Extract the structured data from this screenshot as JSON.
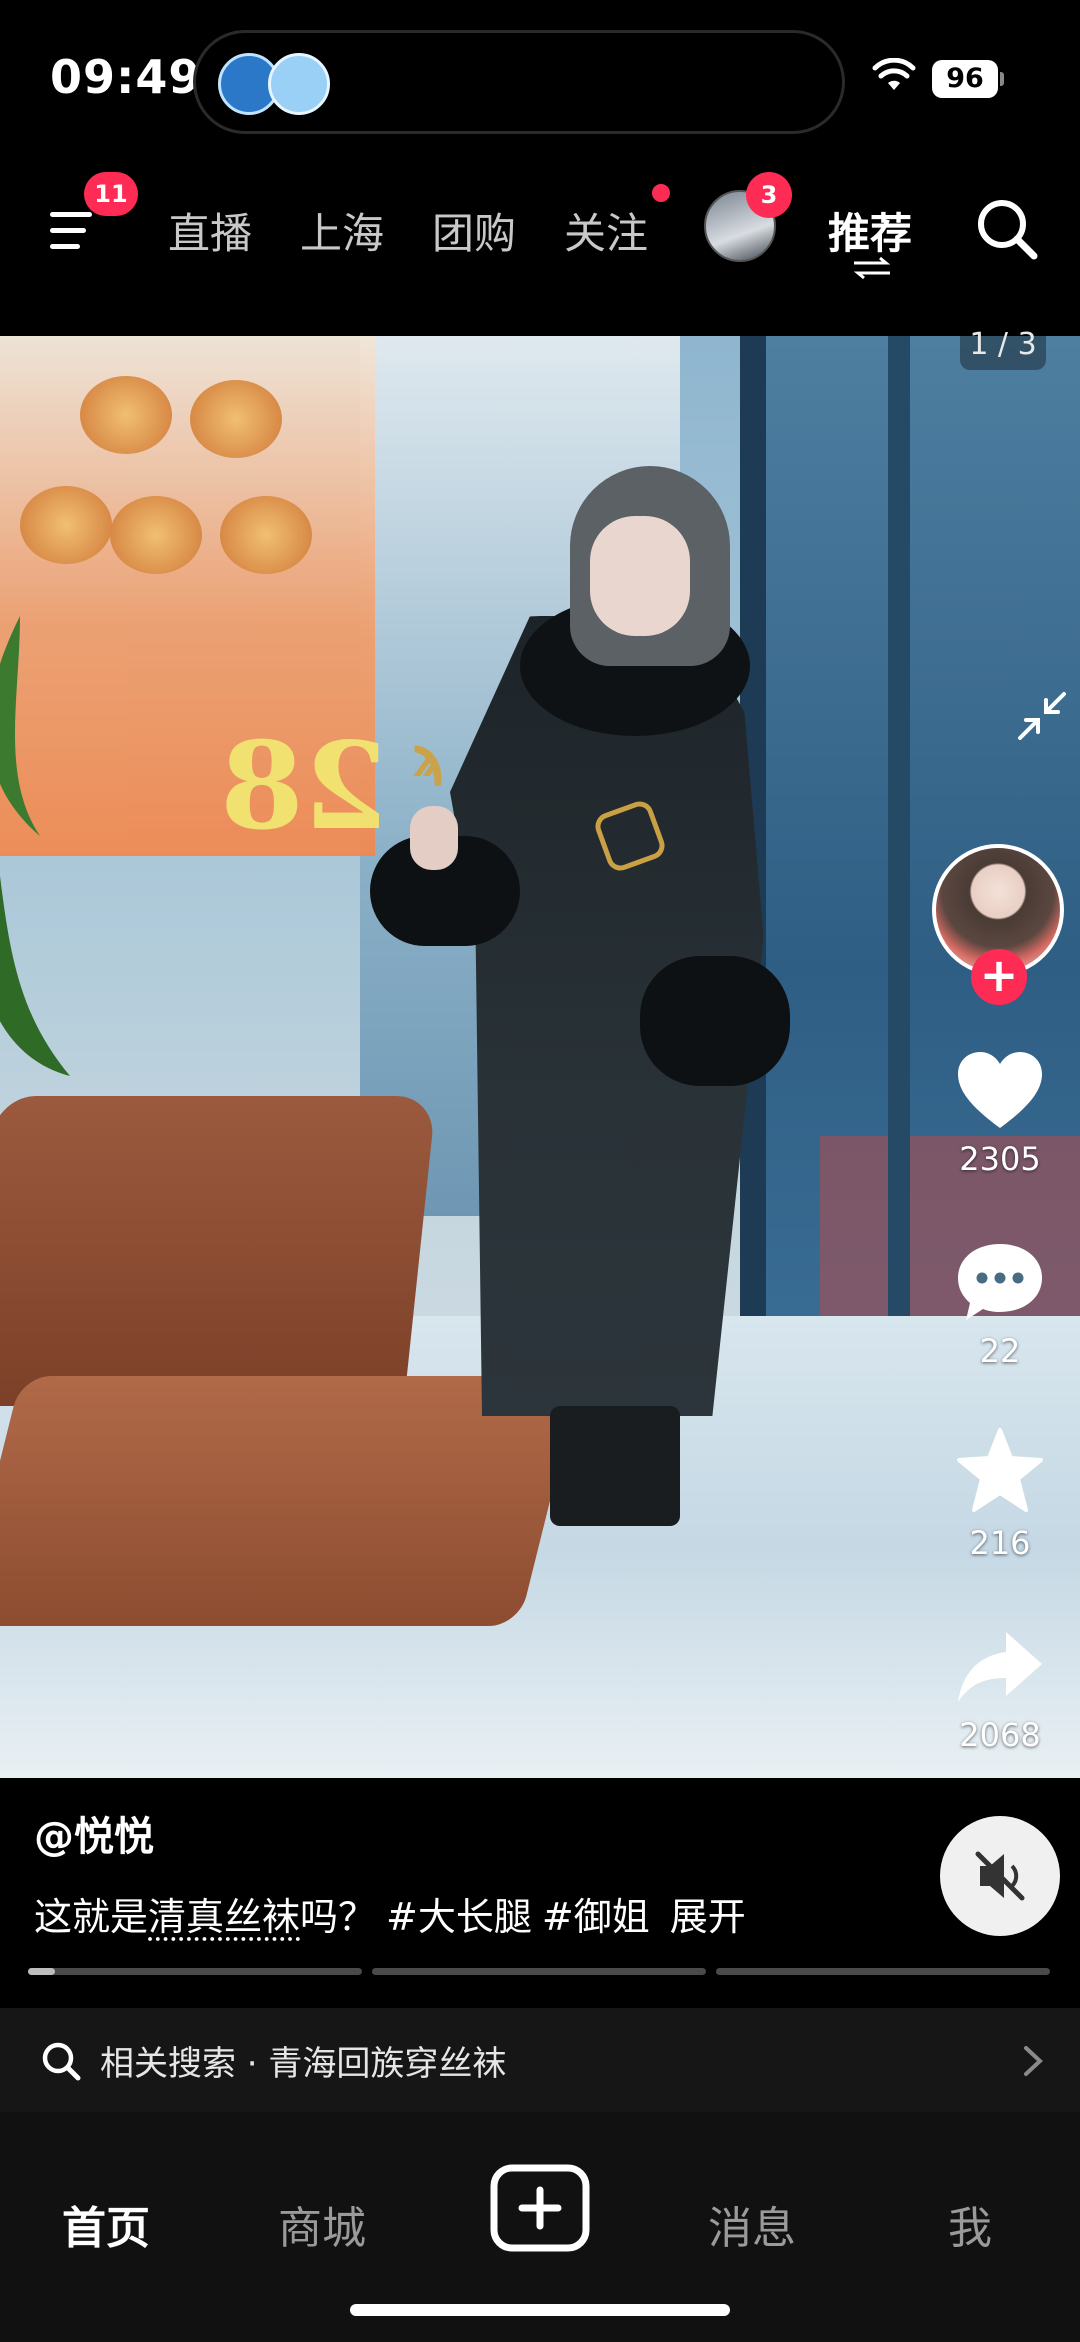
{
  "status_bar": {
    "time": "09:49",
    "battery": "96"
  },
  "top_nav": {
    "menu_badge": "11",
    "tabs": [
      {
        "label": "直播"
      },
      {
        "label": "上海"
      },
      {
        "label": "团购"
      },
      {
        "label": "关注"
      },
      {
        "label": "推荐"
      }
    ],
    "avatar_badge": "3",
    "active_tab": "推荐"
  },
  "media": {
    "page_indicator": "1 / 3",
    "poster_number": "28"
  },
  "actions": {
    "likes": "2305",
    "comments": "22",
    "favorites": "216",
    "shares": "2068"
  },
  "post": {
    "author": "@悦悦",
    "caption_prefix": "这就是",
    "caption_keyword": "清真丝袜",
    "caption_suffix": "吗？",
    "hashtags": [
      "#大长腿",
      "#御姐"
    ],
    "expand": "展开",
    "progress_segments": 3,
    "current_segment_progress": 0.08
  },
  "related_search": {
    "label": "相关搜索 · 青海回族穿丝袜"
  },
  "bottom_nav": {
    "tabs": [
      {
        "label": "首页"
      },
      {
        "label": "商城"
      },
      {
        "label": "消息"
      },
      {
        "label": "我"
      }
    ],
    "active_tab": "首页"
  },
  "colors": {
    "accent": "#fe2c55",
    "background": "#000000",
    "bottom_bar": "#111111"
  },
  "icons": [
    "menu-icon",
    "search-icon",
    "collapse-icon",
    "heart-icon",
    "comment-icon",
    "star-icon",
    "share-icon",
    "mute-icon",
    "chevron-right-icon",
    "plus-icon",
    "wifi-icon"
  ]
}
